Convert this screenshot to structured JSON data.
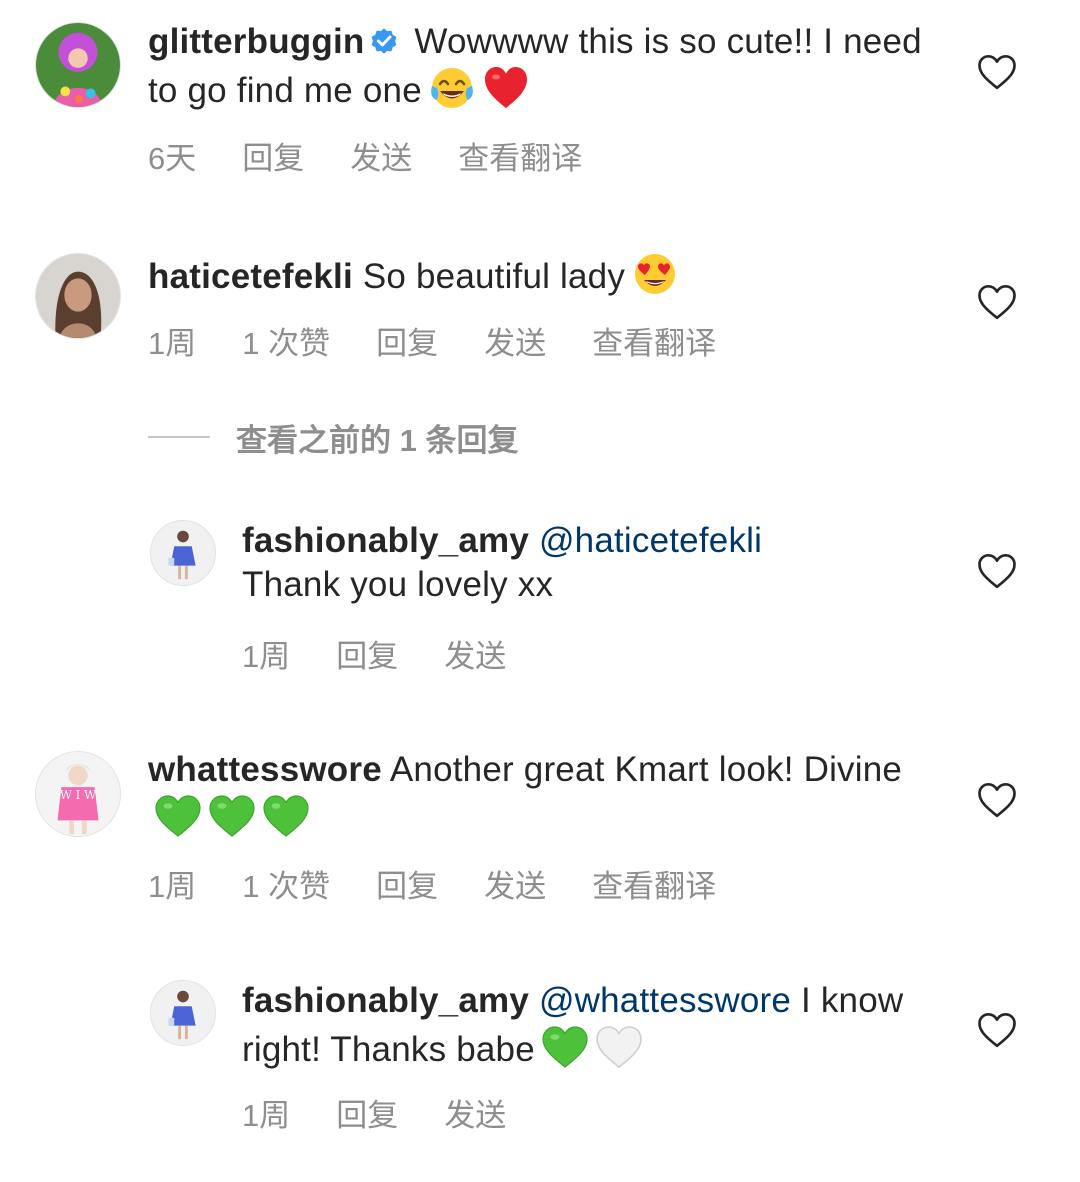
{
  "comments": [
    {
      "username": "glitterbuggin",
      "verified": true,
      "text": "Wowwww this is so cute!! I need to go find me one",
      "emojis": [
        "face-with-tears-of-joy-emoji",
        "red-heart-emoji"
      ],
      "time": "6天",
      "reply": "回复",
      "send": "发送",
      "translate": "查看翻译"
    },
    {
      "username": "haticetefekli",
      "text": "So beautiful lady",
      "emojis": [
        "heart-eyes-emoji"
      ],
      "time": "1周",
      "likes": "1 次赞",
      "reply": "回复",
      "send": "发送",
      "translate": "查看翻译",
      "view_replies": "查看之前的 1 条回复",
      "replies": [
        {
          "username": "fashionably_amy",
          "mention": "@haticetefekli",
          "text": "Thank you lovely xx",
          "time": "1周",
          "reply": "回复",
          "send": "发送"
        }
      ]
    },
    {
      "username": "whattesswore",
      "text": "Another great Kmart look! Divine",
      "emojis": [
        "green-heart-emoji",
        "green-heart-emoji",
        "green-heart-emoji"
      ],
      "time": "1周",
      "likes": "1 次赞",
      "reply": "回复",
      "send": "发送",
      "translate": "查看翻译",
      "replies": [
        {
          "username": "fashionably_amy",
          "mention": "@whattesswore",
          "text": "I know right! Thanks babe",
          "emojis": [
            "green-heart-emoji",
            "white-heart-emoji"
          ],
          "time": "1周",
          "reply": "回复",
          "send": "发送"
        }
      ]
    }
  ],
  "colors": {
    "text": "#262626",
    "muted": "#8e8e8e",
    "mention": "#00376b",
    "verified": "#3897f0"
  }
}
